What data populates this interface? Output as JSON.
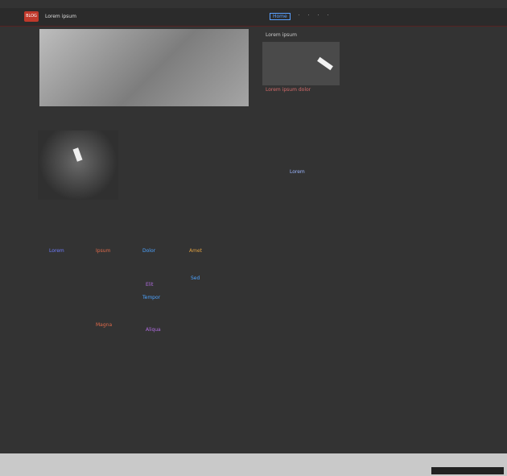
{
  "header": {
    "logo_text": "BLOG",
    "site_title": "Lorem ipsum",
    "nav": [
      "Home",
      "·",
      "·",
      "·",
      "·"
    ]
  },
  "hero": {
    "caption": ""
  },
  "article": {
    "caption": "",
    "body": ""
  },
  "tags": [
    {
      "label": "Lorem",
      "color": "#6f7cff"
    },
    {
      "label": "Ipsum",
      "color": "#e06a4a"
    },
    {
      "label": "Dolor",
      "color": "#4da3ff"
    },
    {
      "label": "Amet",
      "color": "#e0a040"
    },
    {
      "label": "Elit",
      "color": "#b06ce0"
    },
    {
      "label": "Sed",
      "color": "#4da3ff"
    },
    {
      "label": "Tempor",
      "color": "#4da3ff"
    },
    {
      "label": "Magna",
      "color": "#e06a4a"
    },
    {
      "label": "Aliqua",
      "color": "#b06ce0"
    }
  ],
  "sidebar": {
    "title": "Lorem ipsum",
    "link": "Lorem ipsum dolor",
    "item": "Lorem"
  },
  "footer": {
    "text": "",
    "links": ""
  },
  "status": {
    "chip": ""
  }
}
